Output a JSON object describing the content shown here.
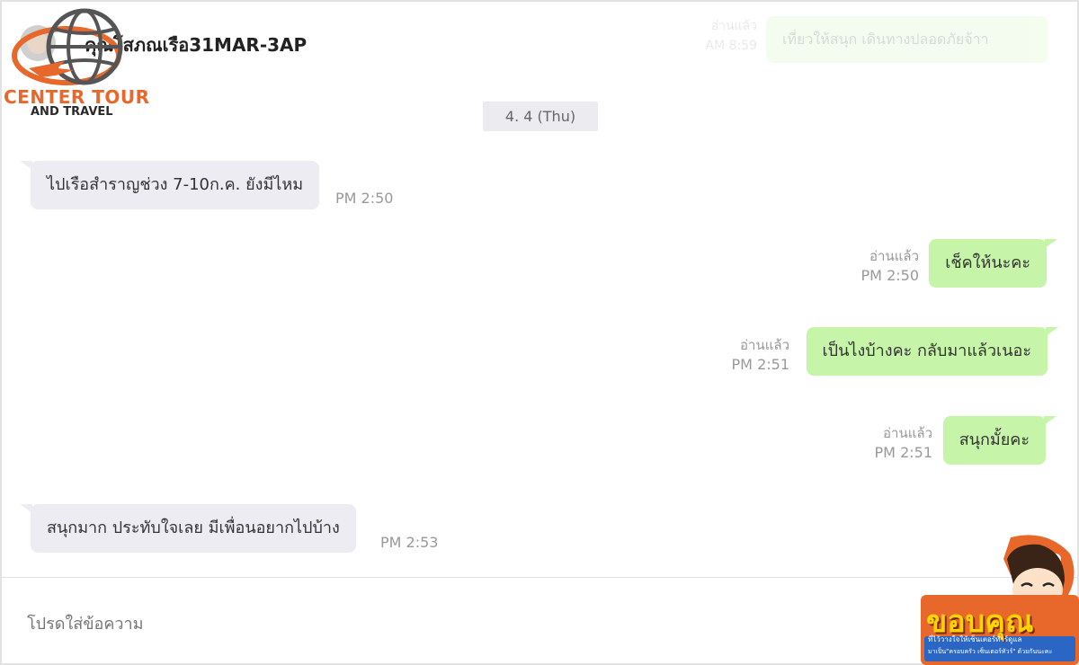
{
  "chat": {
    "title": "คุณโสภณเรือ31MAR-3AP",
    "date_separator": "4. 4 (Thu)"
  },
  "logo": {
    "line1": "CENTER TOUR",
    "line2": "AND TRAVEL"
  },
  "previous_message": {
    "read_label": "อ่านแล้ว",
    "time": "AM 8:59",
    "text": "เที่ยวให้สนุก เดินทางปลอดภัยจ้าา"
  },
  "messages": [
    {
      "direction": "in",
      "text": "ไปเรือสำราญช่วง 7-10ก.ค. ยังมีไหม",
      "time": "PM 2:50"
    },
    {
      "direction": "out",
      "text": "เช็คให้นะคะ",
      "read_label": "อ่านแล้ว",
      "time": "PM 2:50"
    },
    {
      "direction": "out",
      "text": "เป็นไงบ้างคะ กลับมาแล้วเนอะ",
      "read_label": "อ่านแล้ว",
      "time": "PM 2:51"
    },
    {
      "direction": "out",
      "text": "สนุกมั้ยคะ",
      "read_label": "อ่านแล้ว",
      "time": "PM 2:51"
    },
    {
      "direction": "in",
      "text": "สนุกมาก ประทับใจเลย มีเพื่อนอยากไปบ้าง",
      "time": "PM 2:53"
    }
  ],
  "input": {
    "placeholder": "โปรดใส่ข้อความ"
  },
  "sticker": {
    "headline": "ขอบคุณ",
    "subtext1": "ที่ไว้วางใจให้เซ็นเตอร์ทัวร์ดูแล",
    "subtext2": "มาเป็น\"ครอบครัว เซ็นเตอร์ทัวร์\" ด้วยกันนะคะ"
  },
  "colors": {
    "incoming_bubble": "#ececf2",
    "outgoing_bubble": "#c6f4a8",
    "logo_orange": "#e8672b"
  }
}
